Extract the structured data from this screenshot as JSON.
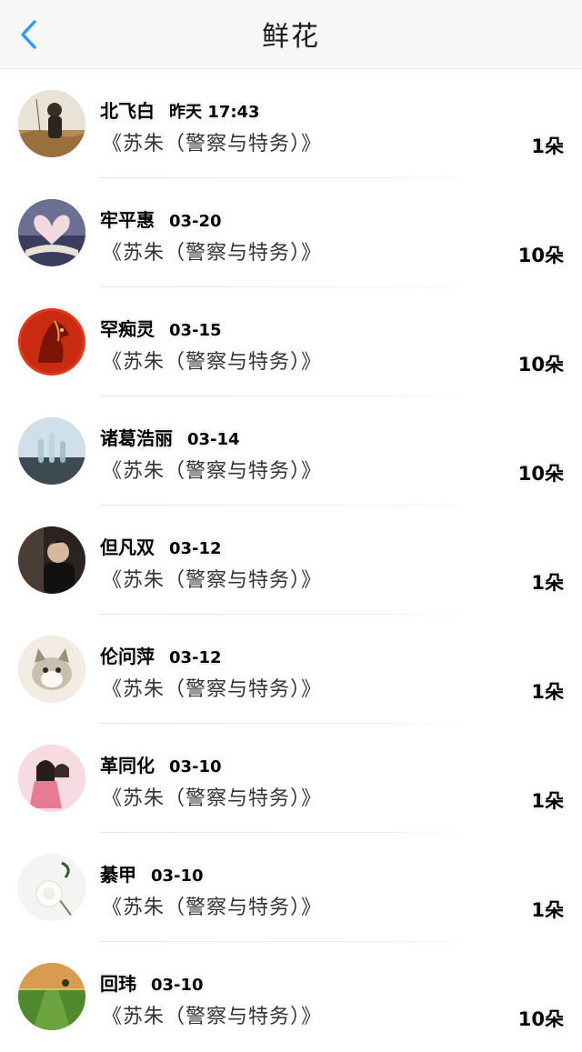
{
  "header": {
    "title": "鲜花",
    "back_icon": "chevron-left-icon",
    "accent_color": "#2b9cf2"
  },
  "entries": [
    {
      "name": "北飞白",
      "date": "昨天 17:43",
      "book": "《苏朱（警察与特务）》",
      "count": "1朵",
      "avatar": "person-in-field"
    },
    {
      "name": "牢平惠",
      "date": "03-20",
      "book": "《苏朱（警察与特务）》",
      "count": "10朵",
      "avatar": "heart-book"
    },
    {
      "name": "罕痴灵",
      "date": "03-15",
      "book": "《苏朱（警察与特务）》",
      "count": "10朵",
      "avatar": "red-horse"
    },
    {
      "name": "诸葛浩丽",
      "date": "03-14",
      "book": "《苏朱（警察与特务）》",
      "count": "10朵",
      "avatar": "glass-bottles"
    },
    {
      "name": "但凡双",
      "date": "03-12",
      "book": "《苏朱（警察与特务）》",
      "count": "1朵",
      "avatar": "man-portrait"
    },
    {
      "name": "伦问萍",
      "date": "03-12",
      "book": "《苏朱（警察与特务）》",
      "count": "1朵",
      "avatar": "kitten"
    },
    {
      "name": "革同化",
      "date": "03-10",
      "book": "《苏朱（警察与特务）》",
      "count": "1朵",
      "avatar": "anime-couple"
    },
    {
      "name": "綦甲",
      "date": "03-10",
      "book": "《苏朱（警察与特务）》",
      "count": "1朵",
      "avatar": "white-rose"
    },
    {
      "name": "回玮",
      "date": "03-10",
      "book": "《苏朱（警察与特务）》",
      "count": "10朵",
      "avatar": "green-field-sunset"
    }
  ]
}
